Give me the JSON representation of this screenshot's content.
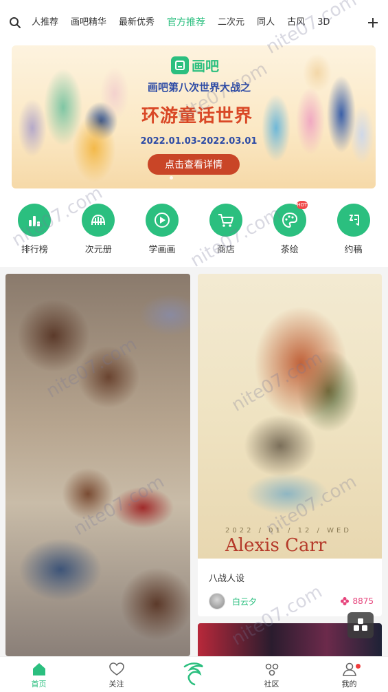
{
  "top_tabs": [
    {
      "label": "人推荐"
    },
    {
      "label": "画吧精华"
    },
    {
      "label": "最新优秀"
    },
    {
      "label": "官方推荐"
    },
    {
      "label": "二次元"
    },
    {
      "label": "同人"
    },
    {
      "label": "古风"
    },
    {
      "label": "3D"
    }
  ],
  "active_tab": "官方推荐",
  "banner": {
    "logo_text": "画吧",
    "subtitle": "画吧第八次世界大战之",
    "title": "环游童话世界",
    "dates": "2022.01.03-2022.03.01",
    "cta": "点击查看详情"
  },
  "categories": [
    {
      "label": "排行榜",
      "icon": "ranking-icon"
    },
    {
      "label": "次元册",
      "icon": "album-icon"
    },
    {
      "label": "学画画",
      "icon": "play-icon"
    },
    {
      "label": "商店",
      "icon": "cart-icon"
    },
    {
      "label": "茶绘",
      "icon": "palette-icon",
      "badge": "HOT"
    },
    {
      "label": "约稿",
      "icon": "commission-icon"
    }
  ],
  "feed": {
    "card2": {
      "art_date": "2022 / 01 / 12 / WED",
      "art_name": "Alexis Carr",
      "caption": "八战人设",
      "author": "白云夕",
      "likes": "8875"
    }
  },
  "bottom_nav": [
    {
      "label": "首页",
      "icon": "home-icon"
    },
    {
      "label": "关注",
      "icon": "heart-icon"
    },
    {
      "label": "",
      "icon": "create-icon"
    },
    {
      "label": "社区",
      "icon": "community-icon"
    },
    {
      "label": "我的",
      "icon": "profile-icon"
    }
  ],
  "watermark": "nite07.com",
  "colors": {
    "accent": "#2bbf7f",
    "like": "#e6447c",
    "badge": "#f04b4b"
  }
}
